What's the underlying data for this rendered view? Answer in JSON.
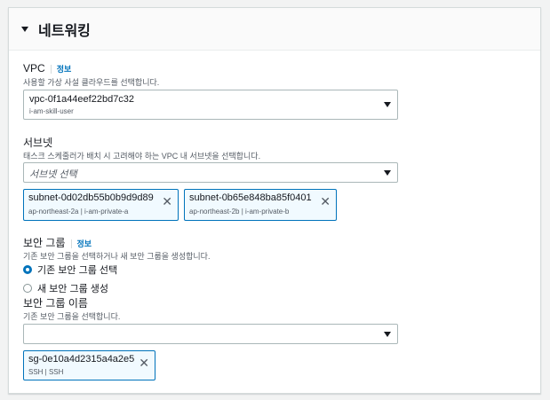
{
  "panel": {
    "title": "네트워킹"
  },
  "vpc": {
    "label": "VPC",
    "info": "정보",
    "description": "사용할 가상 사설 클라우드를 선택합니다.",
    "selected_id": "vpc-0f1a44eef22bd7c32",
    "selected_name": "i-am-skill-user"
  },
  "subnet": {
    "label": "서브넷",
    "description": "태스크 스케줄러가 배치 시 고려해야 하는 VPC 내 서브넷을 선택합니다.",
    "placeholder": "서브넷 선택",
    "tokens": [
      {
        "id": "subnet-0d02db55b0b9d9d89",
        "detail": "ap-northeast-2a | i-am-private-a"
      },
      {
        "id": "subnet-0b65e848ba85f0401",
        "detail": "ap-northeast-2b | i-am-private-b"
      }
    ]
  },
  "security_group": {
    "label": "보안 그룹",
    "info": "정보",
    "description": "기존 보안 그룹을 선택하거나 새 보안 그룹을 생성합니다.",
    "options": [
      {
        "label": "기존 보안 그룹 선택",
        "selected": true
      },
      {
        "label": "새 보안 그룹 생성",
        "selected": false
      }
    ],
    "name_label": "보안 그룹 이름",
    "name_description": "기존 보안 그룹을 선택합니다.",
    "select_value": "",
    "tokens": [
      {
        "id": "sg-0e10a4d2315a4a2e5",
        "detail": "SSH | SSH"
      }
    ]
  },
  "colors": {
    "accent": "#0073bb",
    "text": "#16191f",
    "secondary_text": "#545b64",
    "border": "#aab7b8"
  },
  "icons": {
    "expand": "caret-down-icon",
    "dropdown": "chevron-down-icon",
    "remove": "close-icon"
  }
}
